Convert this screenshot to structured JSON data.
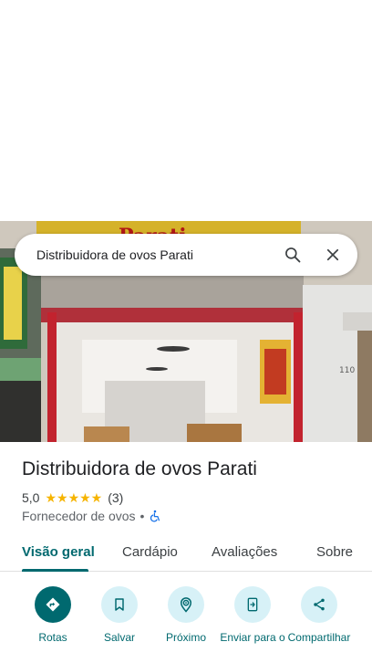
{
  "search": {
    "query": "Distribuidora de ovos Parati"
  },
  "photo": {
    "sign_text": "Parati",
    "door_number": "110"
  },
  "place": {
    "title": "Distribuidora de ovos Parati",
    "rating_value": "5,0",
    "stars_display": "★★★★★",
    "star_rating": 5,
    "review_count": "(3)",
    "category": "Fornecedor de ovos",
    "separator": "•"
  },
  "tabs": [
    {
      "label": "Visão geral",
      "active": true
    },
    {
      "label": "Cardápio",
      "active": false
    },
    {
      "label": "Avaliações",
      "active": false
    },
    {
      "label": "Sobre",
      "active": false
    }
  ],
  "actions": [
    {
      "label": "Rotas",
      "icon": "directions-icon"
    },
    {
      "label": "Salvar",
      "icon": "bookmark-icon"
    },
    {
      "label": "Próximo",
      "icon": "nearby-icon"
    },
    {
      "label": "Enviar para o",
      "icon": "send-to-phone-icon"
    },
    {
      "label": "Compartilhar",
      "icon": "share-icon"
    }
  ],
  "colors": {
    "accent": "#00696f",
    "action_bg": "#d7f1f7",
    "star": "#f6b400"
  }
}
